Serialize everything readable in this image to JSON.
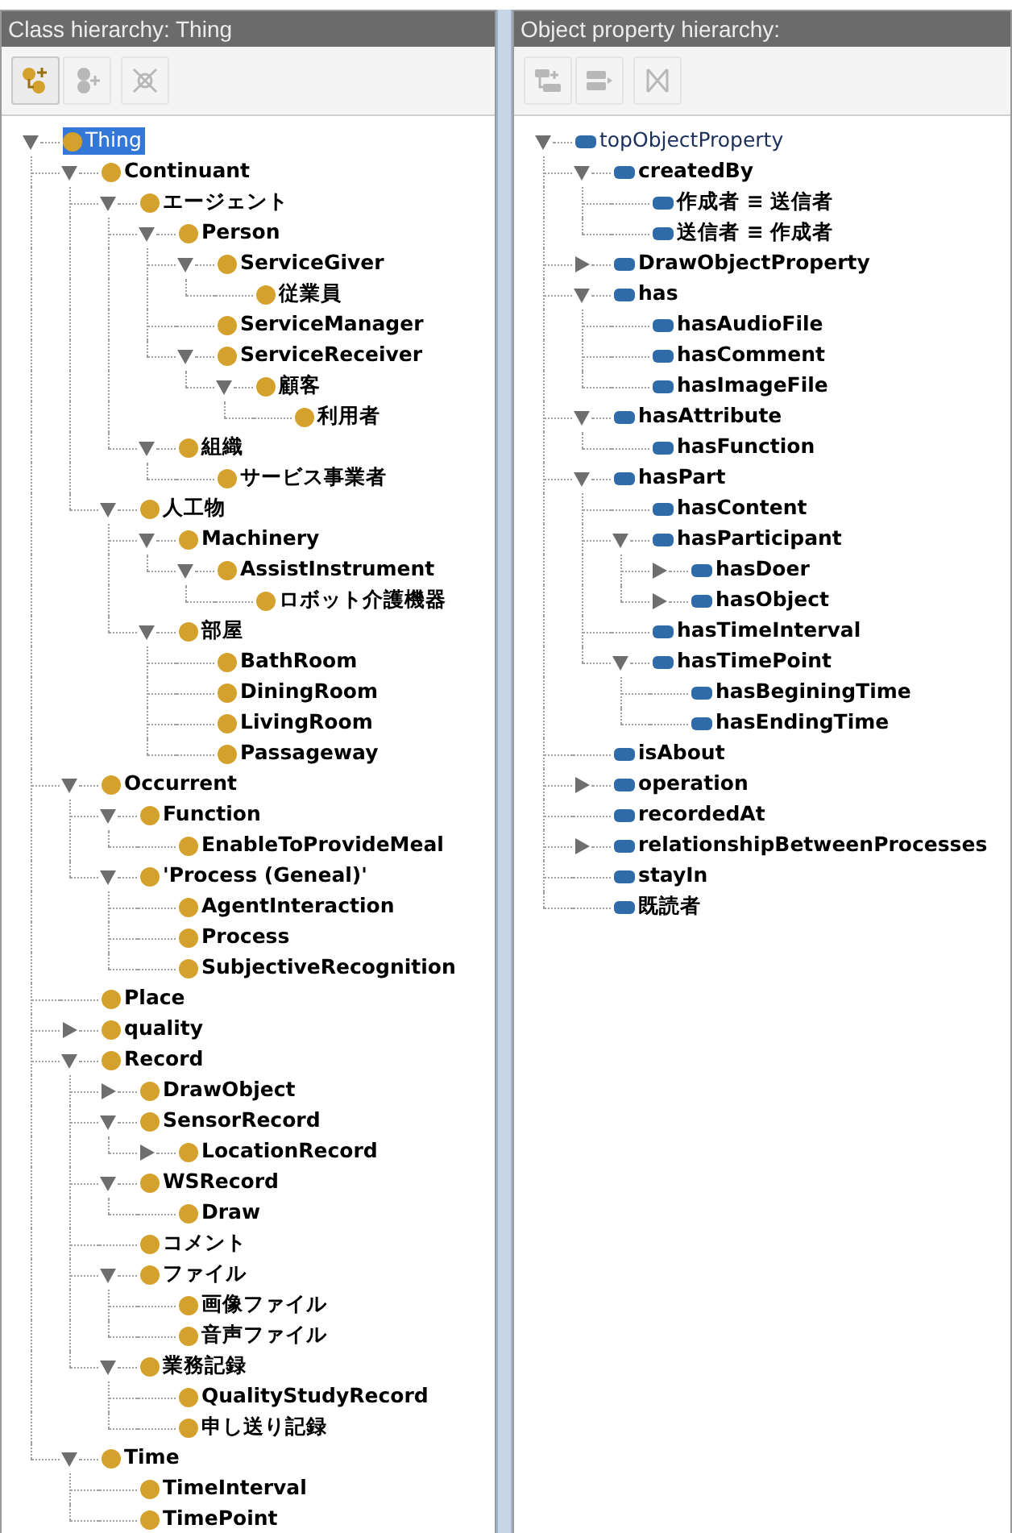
{
  "panels": [
    {
      "title": "Class hierarchy: Thing",
      "kind": "class",
      "toolbar": [
        {
          "kind": "add-child",
          "disabled": false
        },
        {
          "kind": "add-sibling",
          "disabled": true
        },
        {
          "kind": "delete",
          "disabled": true
        }
      ],
      "tree": [
        {
          "label": "Thing",
          "selected": true,
          "expanded": true,
          "children": [
            {
              "label": "Continuant",
              "selected": false,
              "expanded": true,
              "children": [
                {
                  "label": "エージェント",
                  "selected": false,
                  "expanded": true,
                  "children": [
                    {
                      "label": "Person",
                      "selected": false,
                      "expanded": true,
                      "children": [
                        {
                          "label": "ServiceGiver",
                          "selected": false,
                          "expanded": true,
                          "children": [
                            {
                              "label": "従業員",
                              "selected": false
                            }
                          ]
                        },
                        {
                          "label": "ServiceManager",
                          "selected": false
                        },
                        {
                          "label": "ServiceReceiver",
                          "selected": false,
                          "expanded": true,
                          "children": [
                            {
                              "label": "顧客",
                              "selected": false,
                              "expanded": true,
                              "children": [
                                {
                                  "label": "利用者",
                                  "selected": false
                                }
                              ]
                            }
                          ]
                        }
                      ]
                    },
                    {
                      "label": "組織",
                      "selected": false,
                      "expanded": true,
                      "children": [
                        {
                          "label": "サービス事業者",
                          "selected": false
                        }
                      ]
                    }
                  ]
                },
                {
                  "label": "人工物",
                  "selected": false,
                  "expanded": true,
                  "children": [
                    {
                      "label": "Machinery",
                      "selected": false,
                      "expanded": true,
                      "children": [
                        {
                          "label": "AssistInstrument",
                          "selected": false,
                          "expanded": true,
                          "children": [
                            {
                              "label": "ロボット介護機器",
                              "selected": false
                            }
                          ]
                        }
                      ]
                    },
                    {
                      "label": "部屋",
                      "selected": false,
                      "expanded": true,
                      "children": [
                        {
                          "label": "BathRoom",
                          "selected": false
                        },
                        {
                          "label": "DiningRoom",
                          "selected": false
                        },
                        {
                          "label": "LivingRoom",
                          "selected": false
                        },
                        {
                          "label": "Passageway",
                          "selected": false
                        }
                      ]
                    }
                  ]
                }
              ]
            },
            {
              "label": "Occurrent",
              "selected": false,
              "expanded": true,
              "children": [
                {
                  "label": "Function",
                  "selected": false,
                  "expanded": true,
                  "children": [
                    {
                      "label": "EnableToProvideMeal",
                      "selected": false
                    }
                  ]
                },
                {
                  "label": "'Process (Geneal)'",
                  "selected": false,
                  "expanded": true,
                  "children": [
                    {
                      "label": "AgentInteraction",
                      "selected": false
                    },
                    {
                      "label": "Process",
                      "selected": false
                    },
                    {
                      "label": "SubjectiveRecognition",
                      "selected": false
                    }
                  ]
                }
              ]
            },
            {
              "label": "Place",
              "selected": false
            },
            {
              "label": "quality",
              "selected": false,
              "expanded": false
            },
            {
              "label": "Record",
              "selected": false,
              "expanded": true,
              "children": [
                {
                  "label": "DrawObject",
                  "selected": false,
                  "expanded": false
                },
                {
                  "label": "SensorRecord",
                  "selected": false,
                  "expanded": true,
                  "children": [
                    {
                      "label": "LocationRecord",
                      "selected": false,
                      "expanded": false
                    }
                  ]
                },
                {
                  "label": "WSRecord",
                  "selected": false,
                  "expanded": true,
                  "children": [
                    {
                      "label": "Draw",
                      "selected": false
                    }
                  ]
                },
                {
                  "label": "コメント",
                  "selected": false
                },
                {
                  "label": "ファイル",
                  "selected": false,
                  "expanded": true,
                  "children": [
                    {
                      "label": "画像ファイル",
                      "selected": false
                    },
                    {
                      "label": "音声ファイル",
                      "selected": false
                    }
                  ]
                },
                {
                  "label": "業務記録",
                  "selected": false,
                  "expanded": true,
                  "children": [
                    {
                      "label": "QualityStudyRecord",
                      "selected": false
                    },
                    {
                      "label": "申し送り記録",
                      "selected": false
                    }
                  ]
                }
              ]
            },
            {
              "label": "Time",
              "selected": false,
              "expanded": true,
              "children": [
                {
                  "label": "TimeInterval",
                  "selected": false
                },
                {
                  "label": "TimePoint",
                  "selected": false
                }
              ]
            }
          ]
        }
      ]
    },
    {
      "title": "Object property hierarchy:",
      "kind": "property",
      "toolbar": [
        {
          "kind": "add-child",
          "disabled": true
        },
        {
          "kind": "add-sibling",
          "disabled": true
        },
        {
          "kind": "delete",
          "disabled": true
        }
      ],
      "tree": [
        {
          "label": "topObjectProperty",
          "selected": false,
          "expanded": true,
          "children": [
            {
              "label": "createdBy",
              "selected": false,
              "expanded": true,
              "children": [
                {
                  "label": "作成者 ≡ 送信者",
                  "selected": false
                },
                {
                  "label": "送信者 ≡ 作成者",
                  "selected": false
                }
              ]
            },
            {
              "label": "DrawObjectProperty",
              "selected": false,
              "expanded": false
            },
            {
              "label": "has",
              "selected": false,
              "expanded": true,
              "children": [
                {
                  "label": "hasAudioFile",
                  "selected": false
                },
                {
                  "label": "hasComment",
                  "selected": false
                },
                {
                  "label": "hasImageFile",
                  "selected": false
                }
              ]
            },
            {
              "label": "hasAttribute",
              "selected": false,
              "expanded": true,
              "children": [
                {
                  "label": "hasFunction",
                  "selected": false
                }
              ]
            },
            {
              "label": "hasPart",
              "selected": false,
              "expanded": true,
              "children": [
                {
                  "label": "hasContent",
                  "selected": false
                },
                {
                  "label": "hasParticipant",
                  "selected": false,
                  "expanded": true,
                  "children": [
                    {
                      "label": "hasDoer",
                      "selected": false,
                      "expanded": false
                    },
                    {
                      "label": "hasObject",
                      "selected": false,
                      "expanded": false
                    }
                  ]
                },
                {
                  "label": "hasTimeInterval",
                  "selected": false
                },
                {
                  "label": "hasTimePoint",
                  "selected": false,
                  "expanded": true,
                  "children": [
                    {
                      "label": "hasBeginingTime",
                      "selected": false
                    },
                    {
                      "label": "hasEndingTime",
                      "selected": false
                    }
                  ]
                }
              ]
            },
            {
              "label": "isAbout",
              "selected": false
            },
            {
              "label": "operation",
              "selected": false,
              "expanded": false
            },
            {
              "label": "recordedAt",
              "selected": false
            },
            {
              "label": "relationshipBetweenProcesses",
              "selected": false,
              "expanded": false
            },
            {
              "label": "stayIn",
              "selected": false
            },
            {
              "label": "既読者",
              "selected": false
            }
          ]
        }
      ]
    }
  ]
}
